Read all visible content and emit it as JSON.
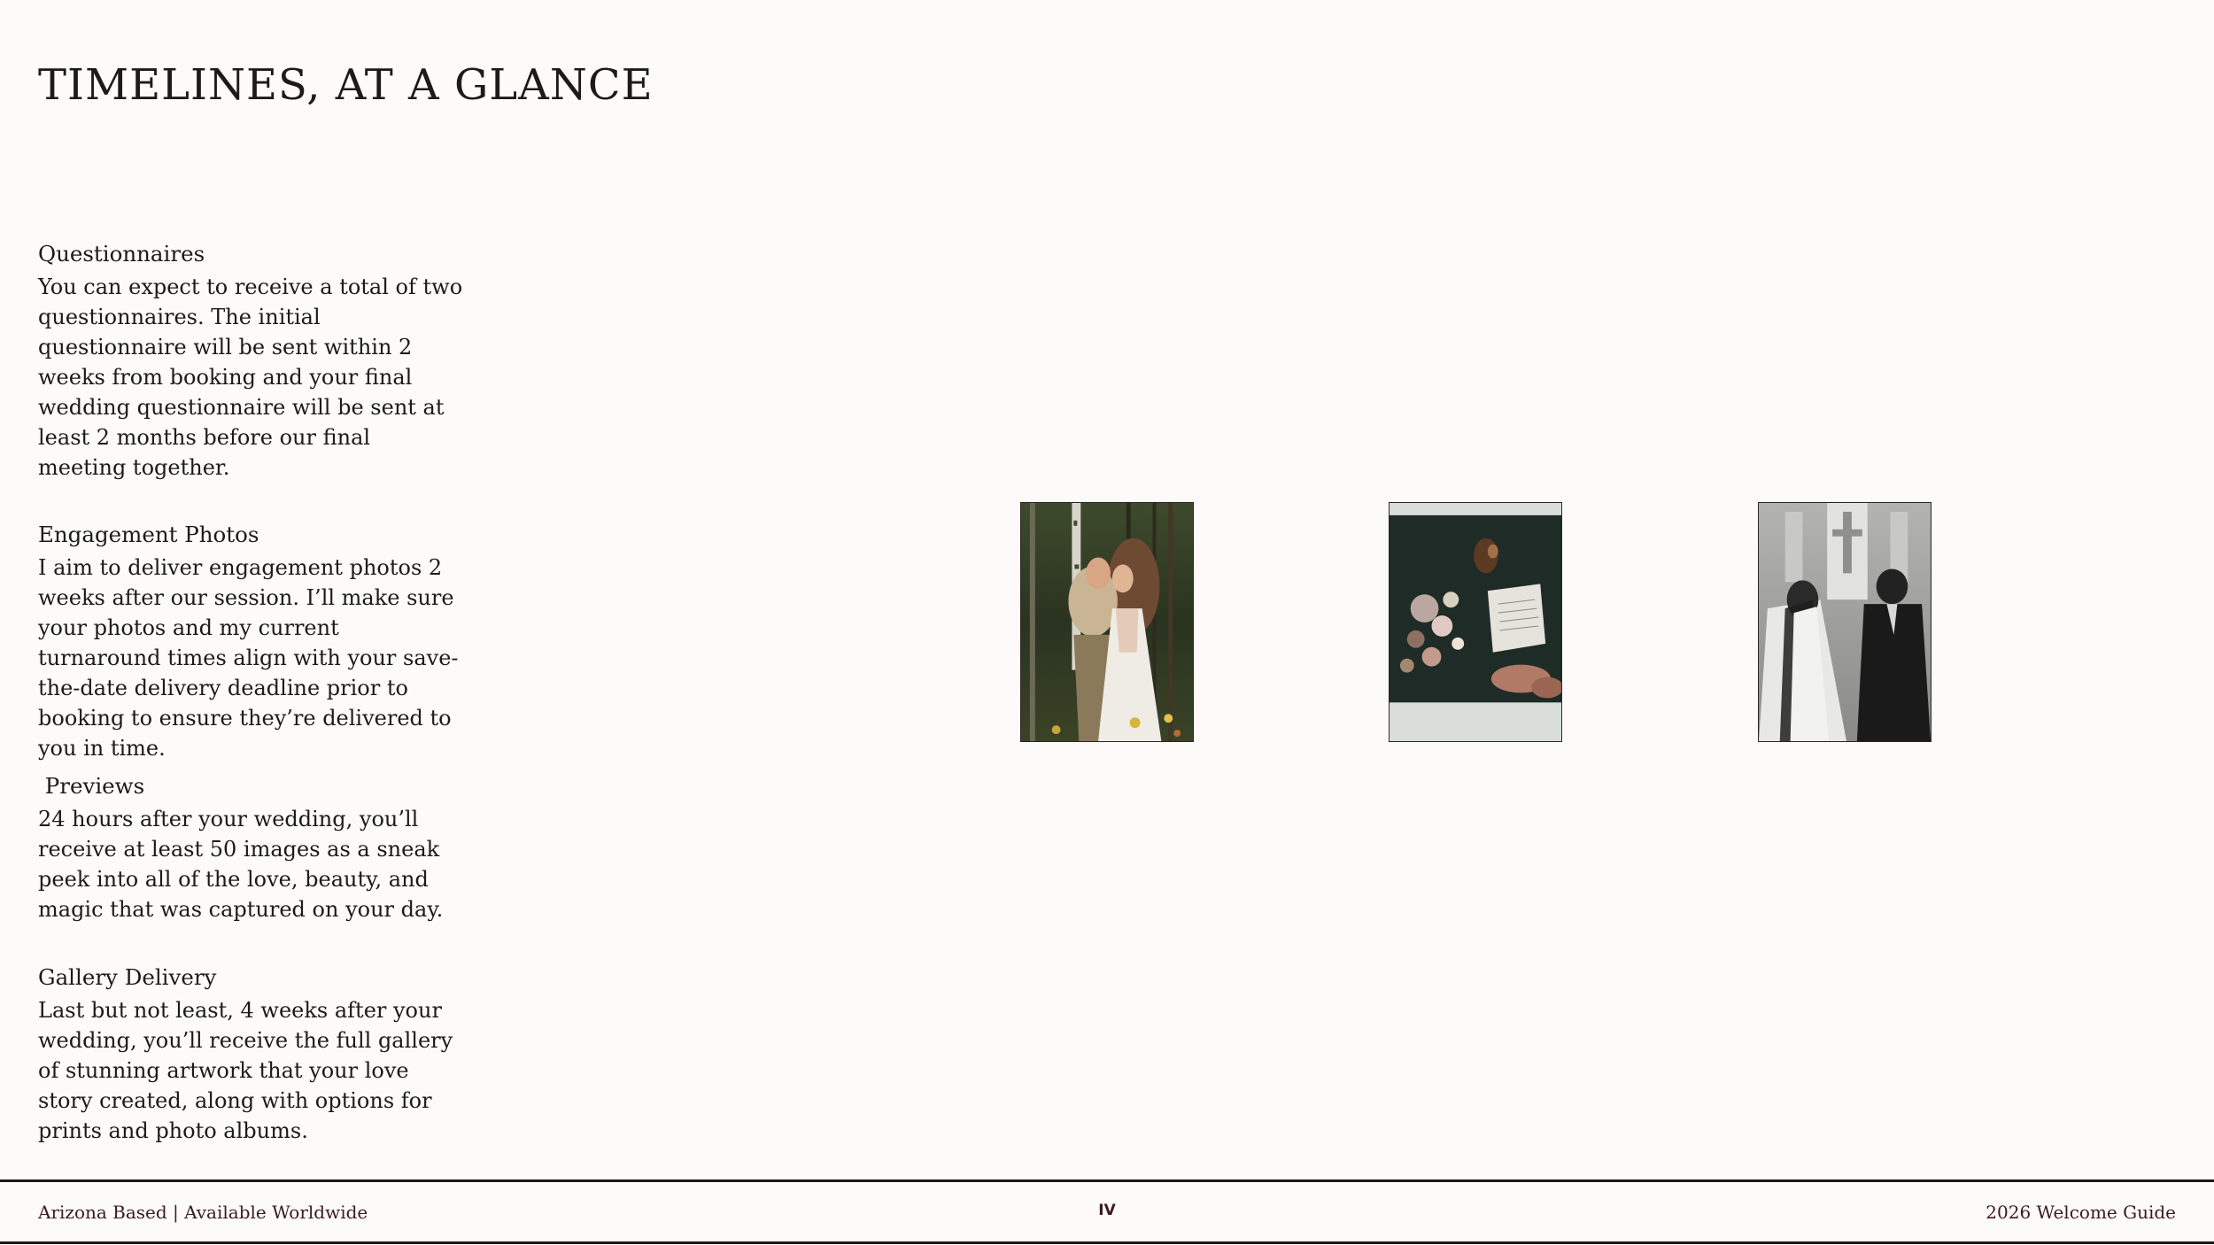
{
  "title": "TIMELINES, AT A GLANCE",
  "sections": [
    {
      "heading": "Questionnaires",
      "body": "You can expect to receive a total of two questionnaires. The initial questionnaire will be sent within 2 weeks from booking and your final wedding questionnaire will be sent at least 2 months before our final meeting together."
    },
    {
      "heading": "Engagement Photos",
      "body": "I aim to deliver engagement photos 2 weeks after our session. I’ll make sure your photos and my current turnaround times align with your save-the-date delivery deadline prior to booking to ensure they’re delivered to you in time."
    },
    {
      "heading": " Previews",
      "body": "24 hours after your wedding, you’ll receive at least 50 images as a sneak peek into all of the love, beauty, and magic that was captured on your day."
    },
    {
      "heading": "Gallery Delivery",
      "body": "Last but not least, 4 weeks after your wedding, you’ll receive the full gallery of stunning artwork that your love story created, along with options for prints and photo albums."
    }
  ],
  "photos": [
    {
      "name": "engagement-couple-photo"
    },
    {
      "name": "flowers-vows-photo"
    },
    {
      "name": "ceremony-bw-photo"
    }
  ],
  "footer": {
    "left": "Arizona Based | Available Worldwide",
    "page_number": "IV",
    "right": "2026 Welcome Guide"
  }
}
